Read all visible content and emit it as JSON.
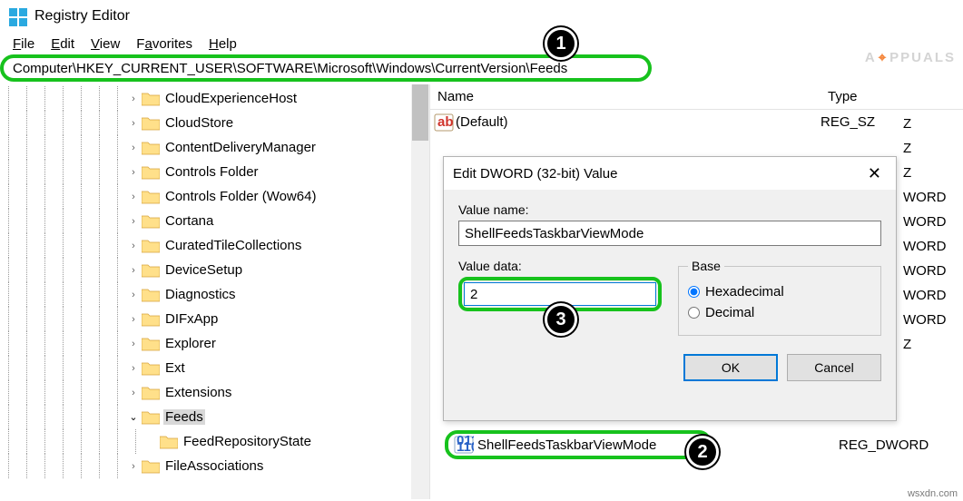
{
  "title": "Registry Editor",
  "menu": {
    "file": "File",
    "edit": "Edit",
    "view": "View",
    "favorites": "Favorites",
    "help": "Help"
  },
  "address": "Computer\\HKEY_CURRENT_USER\\SOFTWARE\\Microsoft\\Windows\\CurrentVersion\\Feeds",
  "tree": [
    {
      "label": "CloudExperienceHost",
      "chev": ">"
    },
    {
      "label": "CloudStore",
      "chev": ">"
    },
    {
      "label": "ContentDeliveryManager",
      "chev": ">"
    },
    {
      "label": "Controls Folder",
      "chev": ">"
    },
    {
      "label": "Controls Folder (Wow64)",
      "chev": ">"
    },
    {
      "label": "Cortana",
      "chev": ">"
    },
    {
      "label": "CuratedTileCollections",
      "chev": ">"
    },
    {
      "label": "DeviceSetup",
      "chev": ">"
    },
    {
      "label": "Diagnostics",
      "chev": ">"
    },
    {
      "label": "DIFxApp",
      "chev": ">"
    },
    {
      "label": "Explorer",
      "chev": ">"
    },
    {
      "label": "Ext",
      "chev": ">"
    },
    {
      "label": "Extensions",
      "chev": ">"
    },
    {
      "label": "Feeds",
      "chev": "v",
      "selected": true
    },
    {
      "label": "FeedRepositoryState",
      "chev": "",
      "child": true
    },
    {
      "label": "FileAssociations",
      "chev": ">"
    }
  ],
  "list_header": {
    "name": "Name",
    "type": "Type"
  },
  "list": {
    "default": {
      "name": "(Default)",
      "type": "REG_SZ"
    },
    "highlighted": {
      "name": "ShellFeedsTaskbarViewMode",
      "type": "REG_DWORD"
    }
  },
  "behind_types": [
    "Z",
    "Z",
    "Z",
    "WORD",
    "WORD",
    "WORD",
    "WORD",
    "WORD",
    "WORD",
    "Z"
  ],
  "dialog": {
    "title": "Edit DWORD (32-bit) Value",
    "value_name_label": "Value name:",
    "value_name": "ShellFeedsTaskbarViewMode",
    "value_data_label": "Value data:",
    "value_data": "2",
    "base_label": "Base",
    "hex": "Hexadecimal",
    "dec": "Decimal",
    "ok": "OK",
    "cancel": "Cancel"
  },
  "badges": {
    "b1": "1",
    "b2": "2",
    "b3": "3"
  },
  "watermark": {
    "left": "A",
    "mid": "⌖",
    "right": "PPUALS"
  },
  "footer": "wsxdn.com"
}
